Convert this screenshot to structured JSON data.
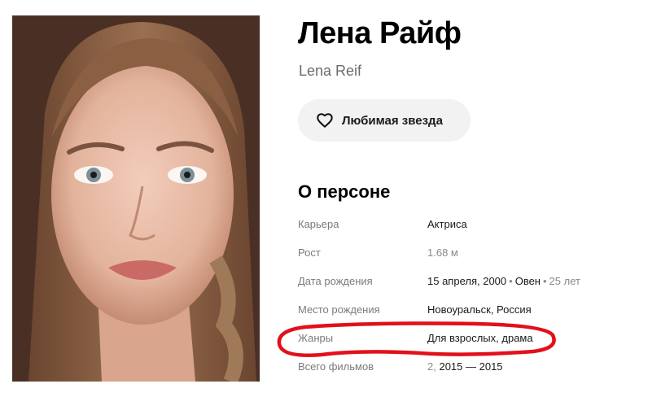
{
  "person": {
    "name_ru": "Лена Райф",
    "name_original": "Lena Reif"
  },
  "actions": {
    "favorite_label": "Любимая звезда"
  },
  "about": {
    "title": "О персоне",
    "rows": [
      {
        "key": "Карьера",
        "value": "Актриса"
      },
      {
        "key": "Рост",
        "value": "1.68 м"
      },
      {
        "key": "Дата рождения",
        "date": "15 апреля, 2000",
        "sign": "Овен",
        "age": "25 лет"
      },
      {
        "key": "Место рождения",
        "value": "Новоуральск, Россия"
      },
      {
        "key": "Жанры",
        "value": "Для взрослых, драма"
      },
      {
        "key": "Всего фильмов",
        "count": "2,",
        "years": "2015 — 2015"
      }
    ]
  },
  "colors": {
    "highlight": "#e2101a",
    "button_bg": "#f2f2f2",
    "muted_text": "#7a7a7a"
  },
  "icons": {
    "favorite": "heart-icon"
  }
}
